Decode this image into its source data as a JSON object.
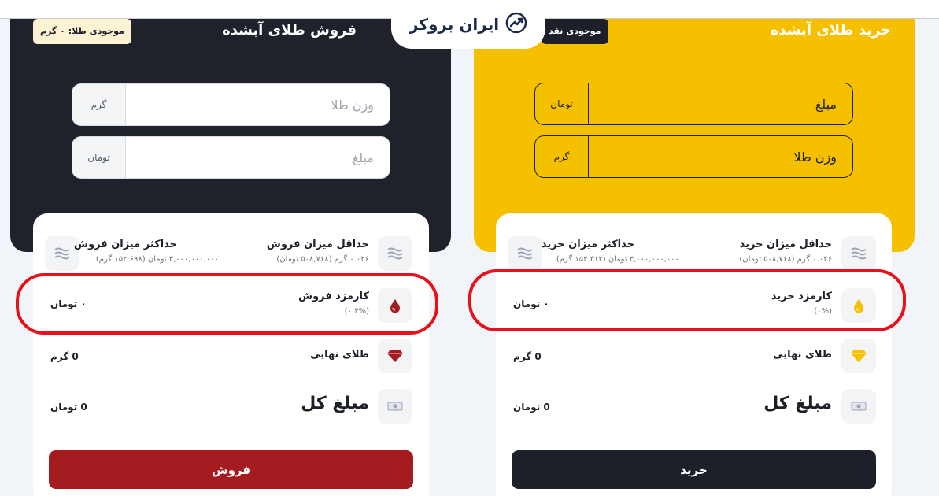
{
  "logo": {
    "text": "ایران بروکر"
  },
  "sell": {
    "title": "فروش طلای آبشده",
    "balance_badge": "موجودی طلا: ۰ گرم",
    "weight_placeholder": "وزن طلا",
    "weight_unit": "گرم",
    "amount_placeholder": "مبلغ",
    "amount_unit": "تومان",
    "min_label": "حداقل میزان فروش",
    "min_detail": "۰.۰۲۶ گرم (۵۰۸,۷۶۸ تومان)",
    "max_label": "حداکثر میزان فروش",
    "max_detail": "۳,۰۰۰,۰۰۰,۰۰۰ تومان (۱۵۲.۶۹۸ گرم)",
    "fee_label": "کارمزد فروش",
    "fee_rate": "(۰.۴%)",
    "fee_value": "۰ تومان",
    "final_gold_label": "طلای نهایی",
    "final_gold_value": "0  گرم",
    "total_label": "مبلغ کل",
    "total_value": "0  تومان",
    "button_label": "فروش"
  },
  "buy": {
    "title": "خرید طلای آبشده",
    "balance_badge": "موجودی نقد",
    "amount_placeholder": "مبلغ",
    "amount_unit": "تومان",
    "weight_placeholder": "وزن طلا",
    "weight_unit": "گرم",
    "min_label": "حداقل میزان خرید",
    "min_detail": "۰.۰۲۶ گرم (۵۰۸,۷۶۸ تومان)",
    "max_label": "حداکثر میزان خرید",
    "max_detail": "۳,۰۰۰,۰۰۰,۰۰۰ تومان (۱۵۳.۳۱۲ گرم)",
    "fee_label": "کارمزد خرید",
    "fee_rate": "(۰%)",
    "fee_value": "۰ تومان",
    "final_gold_label": "طلای نهایی",
    "final_gold_value": "0  گرم",
    "total_label": "مبلغ کل",
    "total_value": "0  تومان",
    "button_label": "خرید"
  },
  "colors": {
    "sell_panel": "#1f222b",
    "buy_panel": "#f4c000",
    "sell_button": "#a51c20",
    "buy_button": "#1d2029",
    "highlight": "#e8101a"
  },
  "icons": {
    "limits": "waves-icon",
    "sell_fee": "drop-icon",
    "buy_fee": "drop-icon",
    "final_gold": "gem-icon",
    "total": "banknote-icon",
    "logo": "chart-trend-icon"
  }
}
